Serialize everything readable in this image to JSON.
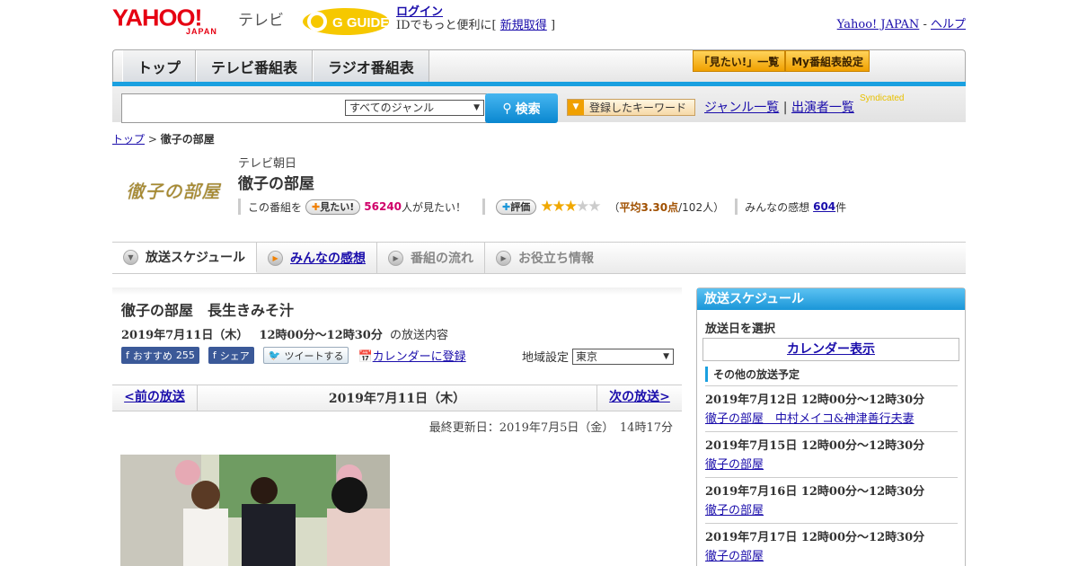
{
  "header": {
    "logo_text": "YAHOO!",
    "logo_sub": "JAPAN",
    "service": "テレビ",
    "gguide": "G GUIDE",
    "login": "ログイン",
    "login_note_pre": "IDでもっと便利に[",
    "register": "新規取得",
    "login_note_post": "]",
    "yahoo_japan": "Yahoo! JAPAN",
    "sep": "-",
    "help": "ヘルプ"
  },
  "nav": {
    "tabs": [
      "トップ",
      "テレビ番組表",
      "ラジオ番組表"
    ],
    "mitai_list": "「見たい!」一覧",
    "my_schedule": "My番組表設定"
  },
  "search": {
    "placeholder": "",
    "genre": "すべてのジャンル",
    "button": "検索",
    "keyword": "登録したキーワード",
    "genre_list": "ジャンル一覧",
    "cast_list": "出演者一覧",
    "syndicated": "Syndicated"
  },
  "breadcrumb": {
    "top": "トップ",
    "sep": ">",
    "current": "徹子の部屋"
  },
  "program": {
    "logo_alt": "徹子の部屋",
    "station": "テレビ朝日",
    "title": "徹子の部屋",
    "this_program": "この番組を",
    "mitai_btn": "見たい!",
    "mitai_count": "56240",
    "mitai_suffix": "人が見たい！",
    "rate_btn": "評価",
    "rating": 3.3,
    "avg_open": "（",
    "avg_label": "平均3.30点",
    "avg_count": "/102人）",
    "impressions_label": "みんなの感想",
    "impressions_count": "604",
    "impressions_suffix": "件"
  },
  "subtabs": [
    "放送スケジュール",
    "みんなの感想",
    "番組の流れ",
    "お役立ち情報"
  ],
  "main": {
    "episode_title": "徹子の部屋　長生きみそ汁",
    "date": "2019年7月11日（木）",
    "time": "12時00分～12時30分",
    "date_suffix": "の放送内容",
    "recommend": "おすすめ",
    "recommend_count": "255",
    "share": "シェア",
    "tweet": "ツイートする",
    "calendar": "カレンダーに登録",
    "region_label": "地域設定",
    "region": "東京",
    "prev": "<前の放送",
    "current": "2019年7月11日（木）",
    "next": "次の放送>",
    "updated": "最終更新日：2019年7月5日（金）　14時17分"
  },
  "side": {
    "header": "放送スケジュール",
    "select_date": "放送日を選択",
    "calendar": "カレンダー表示",
    "other": "その他の放送予定",
    "items": [
      {
        "date": "2019年7月12日  12時00分～12時30分",
        "title": "徹子の部屋　中村メイコ&神津善行夫妻"
      },
      {
        "date": "2019年7月15日  12時00分～12時30分",
        "title": "徹子の部屋"
      },
      {
        "date": "2019年7月16日  12時00分～12時30分",
        "title": "徹子の部屋"
      },
      {
        "date": "2019年7月17日  12時00分～12時30分",
        "title": "徹子の部屋"
      }
    ]
  }
}
